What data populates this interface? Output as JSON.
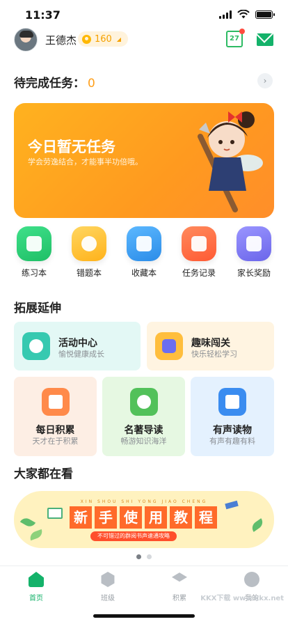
{
  "status_bar": {
    "time": "11:37"
  },
  "header": {
    "username": "王德杰",
    "points": "160",
    "calendar_day": "27"
  },
  "pending": {
    "label": "待完成任务：",
    "count": "0"
  },
  "banner": {
    "title": "今日暂无任务",
    "subtitle": "学会劳逸结合，才能事半功倍哦。",
    "bg_color": "#ffa21e"
  },
  "quick_actions": [
    {
      "label": "练习本",
      "color": "#2ecc71",
      "icon": "notebook-icon"
    },
    {
      "label": "错题本",
      "color": "#ffc23a",
      "icon": "wrong-book-icon"
    },
    {
      "label": "收藏本",
      "color": "#3da1f5",
      "icon": "favorites-icon"
    },
    {
      "label": "任务记录",
      "color": "#ff6b45",
      "icon": "task-record-icon"
    },
    {
      "label": "家长奖励",
      "color": "#7b7bf0",
      "icon": "gift-icon"
    }
  ],
  "extend": {
    "title": "拓展延伸",
    "cards": [
      {
        "title": "活动中心",
        "subtitle": "愉悦健康成长",
        "bg": "#e3f8f5",
        "icon_color": "#36c9b0",
        "icon": "medal-icon"
      },
      {
        "title": "趣味闯关",
        "subtitle": "快乐轻松学习",
        "bg": "#fff4e1",
        "icon_color": "#ffbe3d",
        "icon": "gamepad-icon"
      },
      {
        "title": "每日积累",
        "subtitle": "天才在于积累",
        "bg": "#fdeee4",
        "icon_color": "#ff8a4a",
        "icon": "clipboard-icon"
      },
      {
        "title": "名著导读",
        "subtitle": "畅游知识海洋",
        "bg": "#e6f8e2",
        "icon_color": "#52c15a",
        "icon": "reader-icon"
      },
      {
        "title": "有声读物",
        "subtitle": "有声有趣有料",
        "bg": "#e4f1fe",
        "icon_color": "#3a8cf0",
        "icon": "audio-book-icon"
      }
    ]
  },
  "popular": {
    "title": "大家都在看",
    "banner_pinyin": "XIN SHOU SHI YONG JIAO CHENG",
    "banner_chars": [
      "新",
      "手",
      "使",
      "用",
      "教",
      "程"
    ],
    "banner_sub": "不可错过的群阅书声速通攻略"
  },
  "tabs": [
    {
      "label": "首页",
      "active": true
    },
    {
      "label": "班级",
      "active": false
    },
    {
      "label": "积累",
      "active": false
    },
    {
      "label": "我的",
      "active": false
    }
  ],
  "watermark": "KKX下载 www.kkx.net"
}
